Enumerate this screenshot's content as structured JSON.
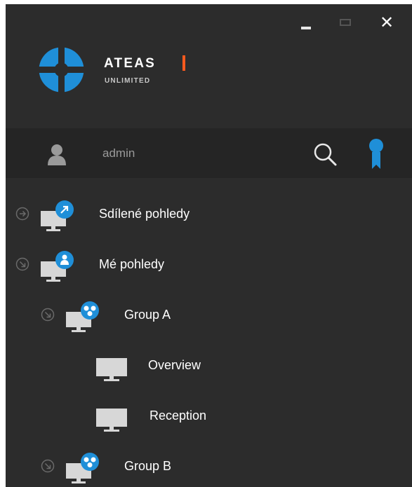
{
  "window": {
    "controls": {
      "minimize": "minimize",
      "maximize": "maximize",
      "close": "✕"
    }
  },
  "brand": {
    "name": "ATEAS",
    "subtitle": "UNLIMITED",
    "colors": {
      "blue": "#1f8fd8",
      "accent": "#ff5a1e"
    }
  },
  "user": {
    "name": "admin",
    "icons": {
      "avatar": "user-icon",
      "search": "search-icon",
      "badge": "award-ribbon-icon"
    }
  },
  "tree": {
    "items": [
      {
        "label": "Sdílené pohledy",
        "expander": "collapsed",
        "overlay": "share-arrow"
      },
      {
        "label": "Mé pohledy",
        "expander": "expanded",
        "overlay": "person"
      },
      {
        "label": "Group A",
        "expander": "expanded",
        "overlay": "group"
      },
      {
        "label": "Overview",
        "expander": "none",
        "overlay": "none"
      },
      {
        "label": "Reception",
        "expander": "none",
        "overlay": "none"
      },
      {
        "label": "Group B",
        "expander": "expanded",
        "overlay": "group"
      }
    ]
  }
}
